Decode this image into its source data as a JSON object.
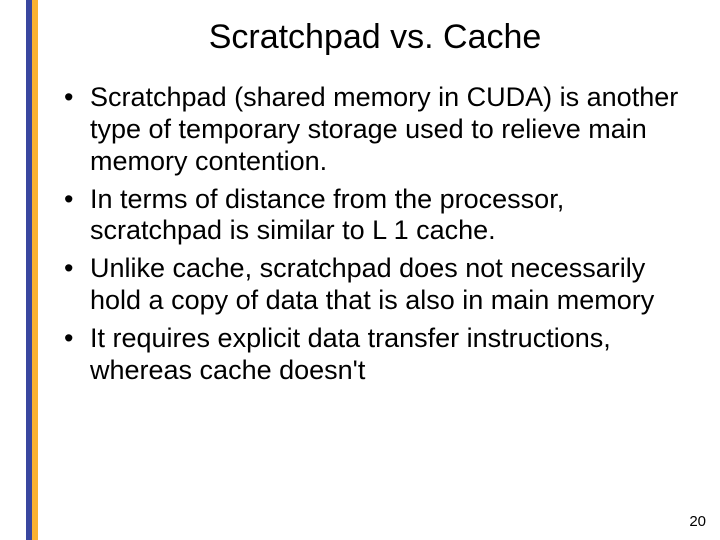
{
  "title": "Scratchpad vs. Cache",
  "bullets": [
    "Scratchpad (shared memory in CUDA) is another type of temporary storage used to relieve main memory contention.",
    "In terms of distance from the processor, scratchpad is similar to L 1 cache.",
    "Unlike cache, scratchpad does not necessarily hold a copy of data that is also in main memory",
    "It requires explicit data transfer instructions, whereas cache doesn't"
  ],
  "page_number": "20"
}
